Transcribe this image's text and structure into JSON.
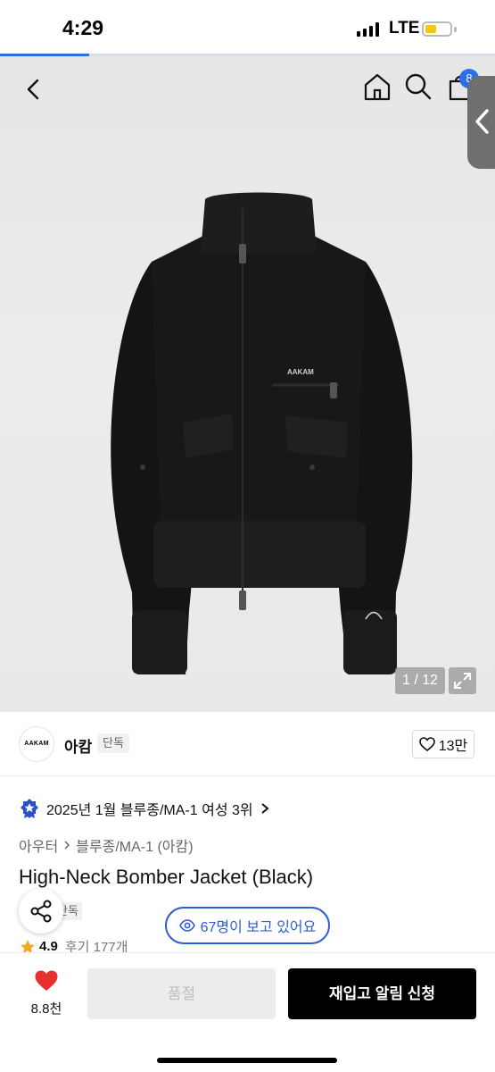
{
  "status_bar": {
    "time": "4:29",
    "network": "LTE",
    "battery_color": "#f5c518"
  },
  "page_load_progress": 0.18,
  "nav": {
    "cart_count": "8"
  },
  "gallery": {
    "counter": "1 / 12",
    "accent": "#2b6ee8"
  },
  "brand": {
    "name": "아캄",
    "logo_text": "AAKAM",
    "exclusive_tag": "단독",
    "likes": "13만"
  },
  "ranking": {
    "text": "2025년 1월 블루종/MA-1 여성 3위"
  },
  "breadcrumb": {
    "category": "아우터",
    "subcategory": "블루종/MA-1 (아캄)"
  },
  "product": {
    "title": "High-Neck Bomber Jacket (Black)",
    "exclusive_tag": "단독",
    "logo_print": "AAKAM"
  },
  "viewers": {
    "text": "67명이 보고 있어요",
    "color": "#2f5bd3"
  },
  "rating": {
    "score": "4.9",
    "reviews": "후기 177개",
    "star_color": "#f5a623"
  },
  "bottom_bar": {
    "wish_count": "8.8천",
    "soldout_label": "품절",
    "restock_label": "재입고 알림 신청",
    "heart_color": "#e8312d"
  }
}
